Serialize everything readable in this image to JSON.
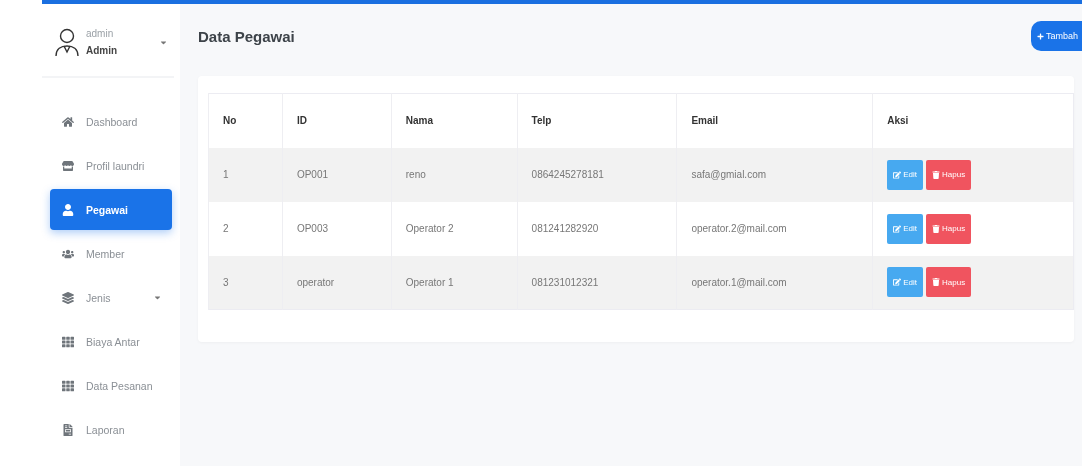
{
  "user": {
    "name": "admin",
    "role": "Admin"
  },
  "sidebar": {
    "items": [
      {
        "label": "Dashboard",
        "selected": false,
        "has_caret": false
      },
      {
        "label": "Profil laundri",
        "selected": false,
        "has_caret": false
      },
      {
        "label": "Pegawai",
        "selected": true,
        "has_caret": false
      },
      {
        "label": "Member",
        "selected": false,
        "has_caret": false
      },
      {
        "label": "Jenis",
        "selected": false,
        "has_caret": true
      },
      {
        "label": "Biaya Antar",
        "selected": false,
        "has_caret": false
      },
      {
        "label": "Data Pesanan",
        "selected": false,
        "has_caret": false
      },
      {
        "label": "Laporan",
        "selected": false,
        "has_caret": false
      }
    ]
  },
  "page": {
    "title": "Data Pegawai",
    "add_button": "Tambah"
  },
  "table": {
    "columns": [
      "No",
      "ID",
      "Nama",
      "Telp",
      "Email",
      "Aksi"
    ],
    "rows": [
      {
        "cells": [
          "1",
          "OP001",
          "reno",
          "0864245278181",
          "safa@gmial.com"
        ],
        "actions": [
          "Edit",
          "Hapus"
        ]
      },
      {
        "cells": [
          "2",
          "OP003",
          "Operator 2",
          "081241282920",
          "operator.2@mail.com"
        ],
        "actions": [
          "Edit",
          "Hapus"
        ]
      },
      {
        "cells": [
          "3",
          "operator",
          "Operator 1",
          "081231012321",
          "operator.1@mail.com"
        ],
        "actions": [
          "Edit",
          "Hapus"
        ]
      }
    ]
  }
}
